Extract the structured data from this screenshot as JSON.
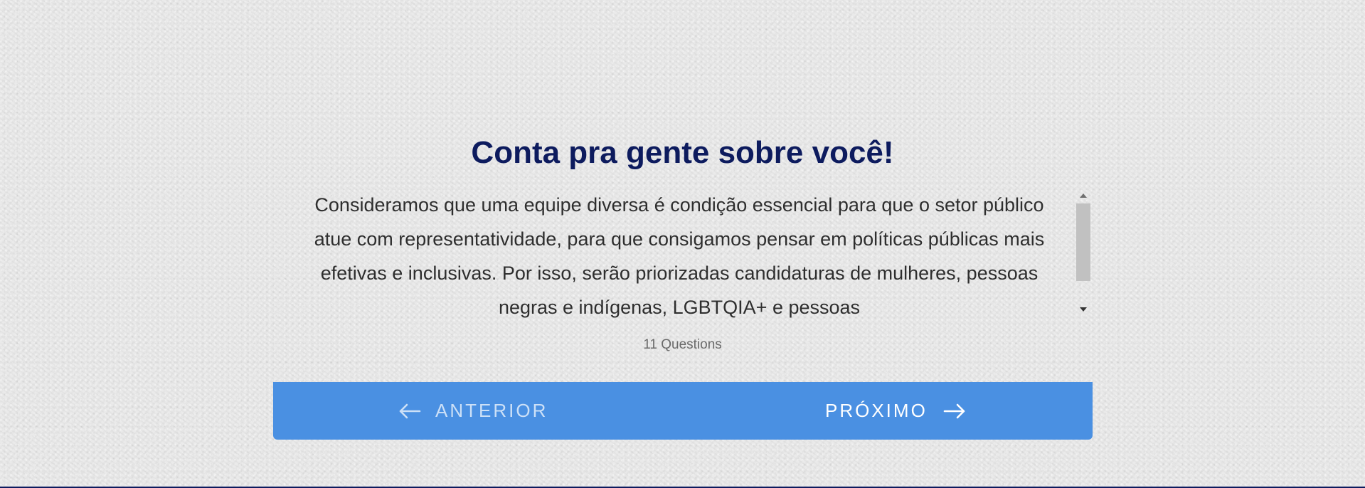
{
  "intro": {
    "title": "Conta pra gente sobre você!",
    "description": "Consideramos que uma equipe diversa é condição essencial para que o setor público atue com representatividade, para que consigamos pensar em políticas públicas mais efetivas e inclusivas. Por isso, serão priorizadas candidaturas de mulheres, pessoas negras e indígenas, LGBTQIA+ e pessoas",
    "question_count": "11 Questions"
  },
  "navigation": {
    "prev_label": "ANTERIOR",
    "prev_icon": "arrow-left-icon",
    "next_label": "PRÓXIMO",
    "next_icon": "arrow-right-icon",
    "bar_color": "#4a90e2"
  },
  "colors": {
    "title": "#0d1b5e",
    "text": "#2e2e2e",
    "bottom_line": "#0d1b5e"
  }
}
